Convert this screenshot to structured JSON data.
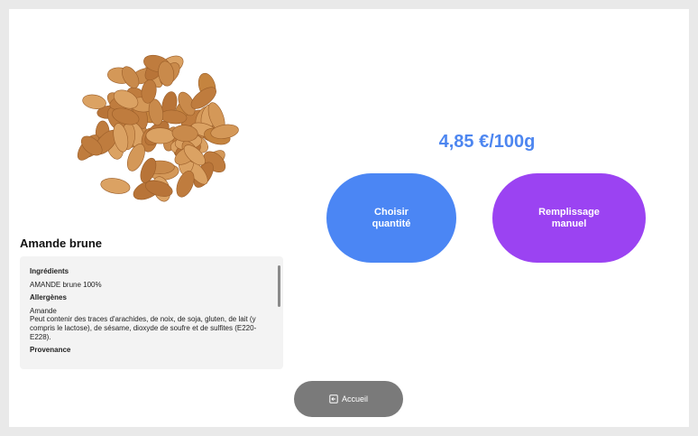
{
  "product": {
    "name": "Amande brune",
    "image_icon": "almonds-image"
  },
  "info": {
    "sections": [
      {
        "heading": "Ingrédients",
        "text": "AMANDE brune 100%"
      },
      {
        "heading": "Allergènes",
        "text": "Amande\nPeut contenir des traces d'arachides, de noix, de soja, gluten, de lait (y compris le lactose), de sésame, dioxyde de soufre et de sulfites (E220-E228)."
      },
      {
        "heading": "Provenance",
        "text": ""
      }
    ]
  },
  "price": "4,85 €/100g",
  "buttons": {
    "quantity_label": "Choisir\nquantité",
    "manual_label": "Remplissage\nmanuel",
    "home_label": "Accueil"
  },
  "colors": {
    "price": "#4d86f0",
    "quantity_button": "#4b86f4",
    "manual_button": "#9b43f2",
    "home_button": "#7a7a7a"
  }
}
